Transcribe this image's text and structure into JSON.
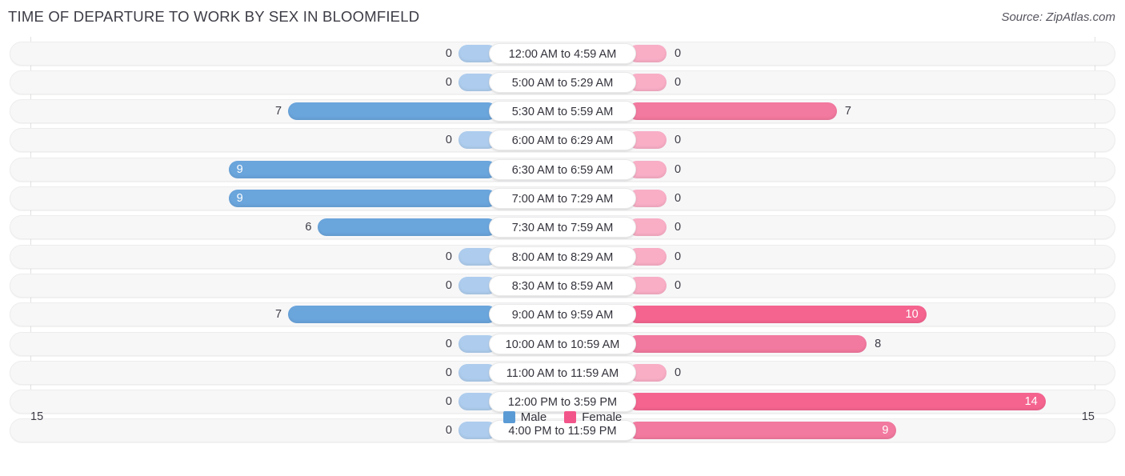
{
  "header": {
    "title": "TIME OF DEPARTURE TO WORK BY SEX IN BLOOMFIELD",
    "source": "Source: ZipAtlas.com"
  },
  "legend": {
    "items": [
      {
        "label": "Male",
        "color": "#5b9bd5"
      },
      {
        "label": "Female",
        "color": "#f2558a"
      }
    ]
  },
  "axis": {
    "left_max": "15",
    "right_max": "15"
  },
  "chart_data": {
    "type": "bar",
    "subtype": "diverging-bar",
    "title": "TIME OF DEPARTURE TO WORK BY SEX IN BLOOMFIELD",
    "xlabel": "",
    "ylabel": "",
    "xlim": [
      15,
      15
    ],
    "grid": false,
    "legend_position": "bottom-center",
    "categories": [
      "12:00 AM to 4:59 AM",
      "5:00 AM to 5:29 AM",
      "5:30 AM to 5:59 AM",
      "6:00 AM to 6:29 AM",
      "6:30 AM to 6:59 AM",
      "7:00 AM to 7:29 AM",
      "7:30 AM to 7:59 AM",
      "8:00 AM to 8:29 AM",
      "8:30 AM to 8:59 AM",
      "9:00 AM to 9:59 AM",
      "10:00 AM to 10:59 AM",
      "11:00 AM to 11:59 AM",
      "12:00 PM to 3:59 PM",
      "4:00 PM to 11:59 PM"
    ],
    "series": [
      {
        "name": "Male",
        "direction": "left",
        "color": "#6aa5dc",
        "values": [
          0,
          0,
          7,
          0,
          9,
          9,
          6,
          0,
          0,
          7,
          0,
          0,
          0,
          0
        ],
        "labels": [
          "0",
          "0",
          "7",
          "0",
          "9",
          "9",
          "6",
          "0",
          "0",
          "7",
          "0",
          "0",
          "0",
          "0"
        ]
      },
      {
        "name": "Female",
        "direction": "right",
        "color": "#f2799f",
        "values": [
          0,
          0,
          7,
          0,
          0,
          0,
          0,
          0,
          0,
          10,
          8,
          0,
          14,
          9
        ],
        "labels": [
          "0",
          "0",
          "7",
          "0",
          "0",
          "0",
          "0",
          "0",
          "0",
          "10",
          "8",
          "0",
          "14",
          "9"
        ]
      }
    ]
  }
}
